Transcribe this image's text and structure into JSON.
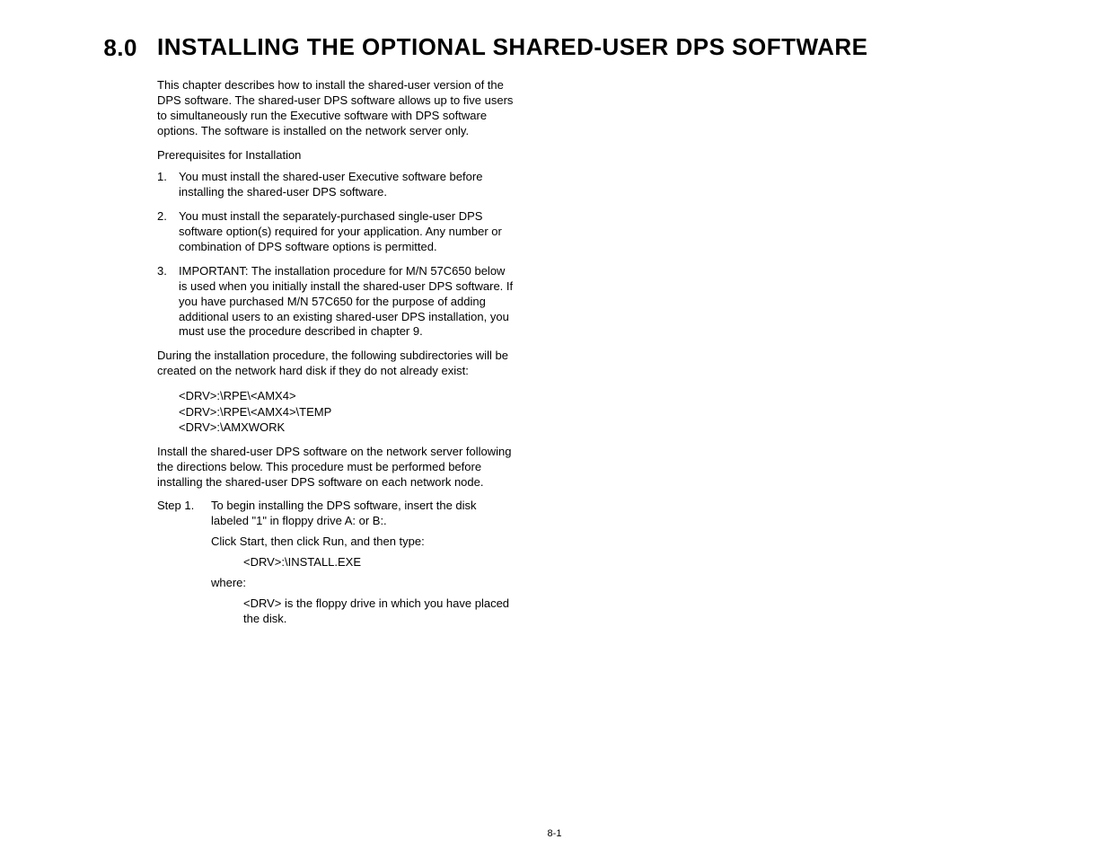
{
  "sectionNumber": "8.0",
  "sectionTitle": "INSTALLING THE OPTIONAL SHARED-USER DPS SOFTWARE",
  "intro": "This chapter describes how to install the shared-user version of the DPS software. The shared-user DPS software allows up to five users to simultaneously run the Executive software with DPS software options. The software is installed on the network server only.",
  "prereqTitle": "Prerequisites for Installation",
  "prereqs": [
    {
      "num": "1.",
      "text": "You must install the shared-user Executive software before installing the shared-user DPS software."
    },
    {
      "num": "2.",
      "text": "You must install the separately-purchased single-user DPS software option(s) required for your application. Any number or combination of DPS software options is permitted."
    },
    {
      "num": "3.",
      "text": "IMPORTANT: The installation procedure for M/N 57C650 below is used when you initially install the shared-user DPS software. If you have purchased M/N 57C650 for the purpose of adding additional users to an existing shared-user DPS installation, you must use the procedure described in chapter 9."
    }
  ],
  "duringPara": "During the installation procedure, the following subdirectories will be created on the network hard disk if they do not already exist:",
  "paths": {
    "p1": "<DRV>:\\RPE\\<AMX4>",
    "p2": "<DRV>:\\RPE\\<AMX4>\\TEMP",
    "p3": "<DRV>:\\AMXWORK"
  },
  "installPara": "Install the shared-user DPS software on the network server following the directions below. This procedure must be performed before installing the shared-user DPS software on each network node.",
  "step1Label": "Step 1.",
  "step1": {
    "line1": "To begin installing the DPS software, insert the disk labeled \"1\" in floppy drive A: or B:.",
    "line2": "Click Start, then click Run, and then type:",
    "cmd": "<DRV>:\\INSTALL.EXE",
    "where": "where:",
    "drvDef": "<DRV> is the floppy drive in which you have placed the disk."
  },
  "pageNumber": "8-1"
}
